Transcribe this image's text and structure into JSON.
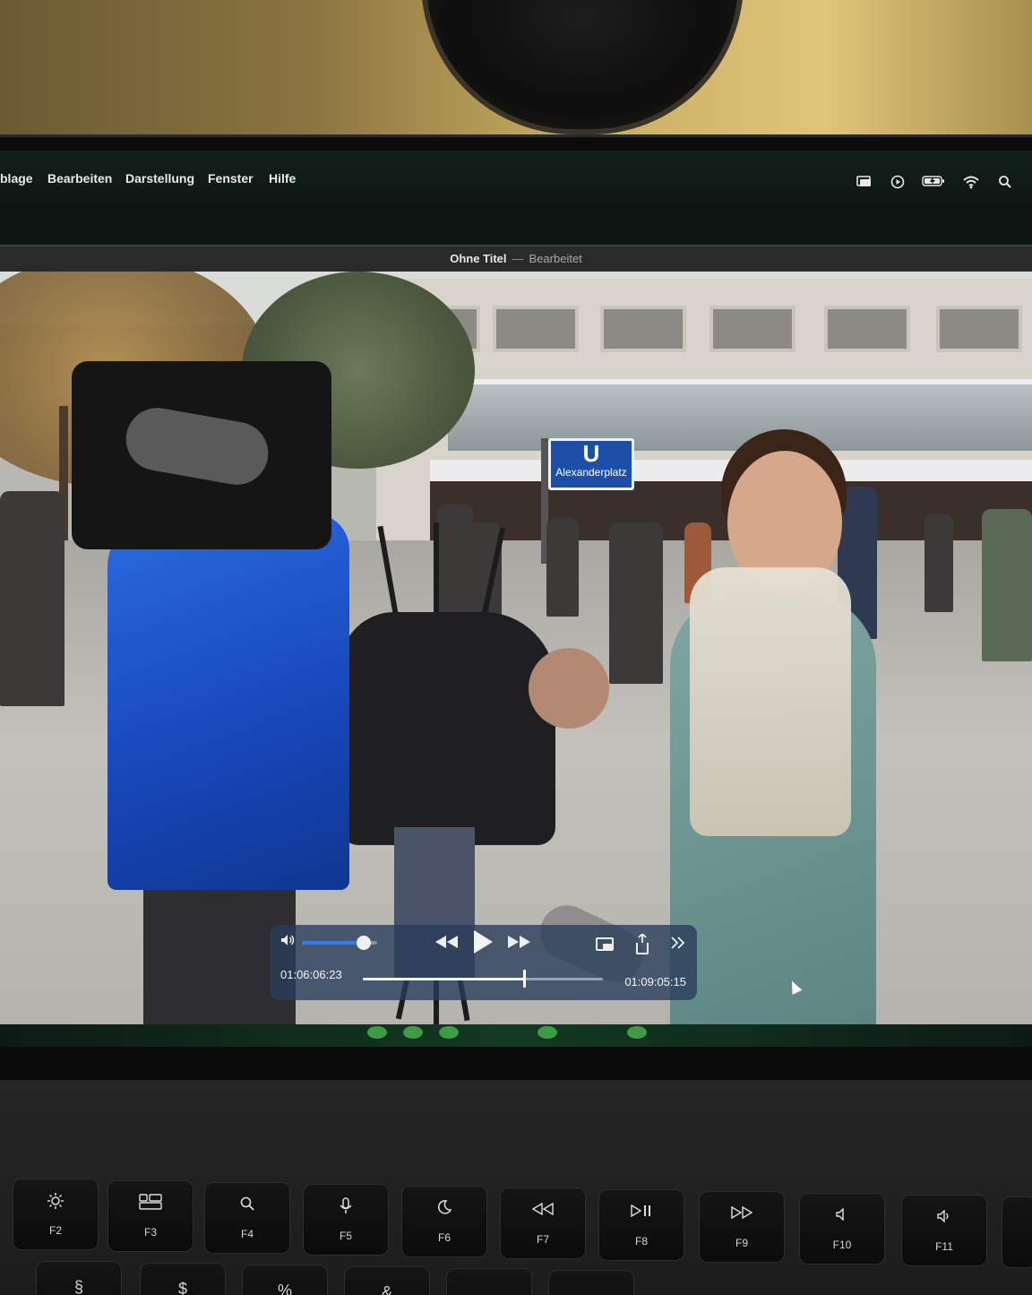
{
  "menubar": {
    "items": [
      "blage",
      "Bearbeiten",
      "Darstellung",
      "Fenster",
      "Hilfe"
    ],
    "status_icons": [
      "screen-mirroring-icon",
      "play-circle-icon",
      "battery-icon",
      "wifi-icon",
      "search-icon"
    ]
  },
  "window": {
    "title": "Ohne Titel",
    "separator": "—",
    "subtitle": "Bearbeitet"
  },
  "video_scene": {
    "sign_letter": "U",
    "sign_name": "Alexanderplatz"
  },
  "player": {
    "volume_level": 0.82,
    "elapsed": "01:06:06:23",
    "remaining": "01:09:05:15",
    "progress": 0.67,
    "icons": {
      "volume": "speaker-icon",
      "rewind": "rewind-icon",
      "play": "play-icon",
      "fast_forward": "fast-forward-icon",
      "pip": "picture-in-picture-icon",
      "share": "share-icon",
      "more": "chevron-double-right-icon"
    }
  },
  "keyboard": {
    "function_keys": [
      {
        "label": "F2",
        "icon": "brightness-icon"
      },
      {
        "label": "F3",
        "icon": "mission-control-icon"
      },
      {
        "label": "F4",
        "icon": "search-icon"
      },
      {
        "label": "F5",
        "icon": "microphone-icon"
      },
      {
        "label": "F6",
        "icon": "moon-icon"
      },
      {
        "label": "F7",
        "icon": "rewind-icon"
      },
      {
        "label": "F8",
        "icon": "play-pause-icon"
      },
      {
        "label": "F9",
        "icon": "fast-forward-icon"
      },
      {
        "label": "F10",
        "icon": "mute-icon"
      },
      {
        "label": "F11",
        "icon": "volume-down-icon"
      }
    ],
    "number_row": [
      "§",
      "$",
      "%",
      "&"
    ]
  }
}
